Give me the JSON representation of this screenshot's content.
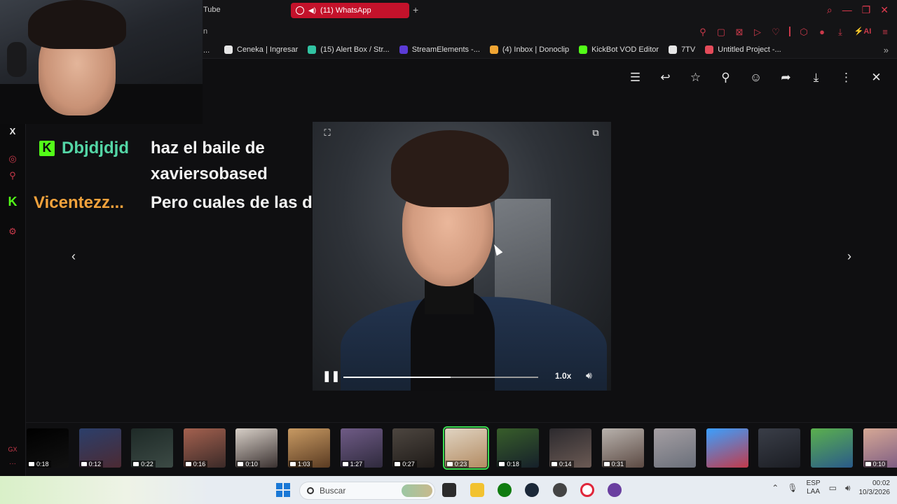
{
  "browser": {
    "tab_youtube_label": "Tube",
    "tab_active_label": "(11) WhatsApp",
    "url_fragment": "n",
    "bookmarks": [
      {
        "label": "Ceneka | Ingresar",
        "color": "#e6e6e6"
      },
      {
        "label": "(15) Alert Box / Str...",
        "color": "#31c3a2"
      },
      {
        "label": "StreamElements -...",
        "color": "#5b3bd6"
      },
      {
        "label": "(4) Inbox | Donoclip",
        "color": "#f0a533"
      },
      {
        "label": "KickBot VOD Editor",
        "color": "#53fc18"
      },
      {
        "label": "7TV",
        "color": "#e6e6e6"
      },
      {
        "label": "Untitled Project -...",
        "color": "#e44b5a"
      }
    ],
    "bookmark_overflow": "..."
  },
  "chat": {
    "messages": [
      {
        "user": "Dbjdjdjd",
        "user_color": "#54d6a6",
        "has_badge": true,
        "text": "haz el baile de xaviersobased"
      },
      {
        "user": "Vicentezz...",
        "user_color": "#f2a23c",
        "has_badge": false,
        "text": "Pero cuales de las dos"
      }
    ]
  },
  "sidebar": {
    "close_icon": "X"
  },
  "player": {
    "speed_label": "1.0x",
    "progress": 0.55,
    "playing": true
  },
  "thumbnails": [
    {
      "duration": "0:18",
      "c1": "#000000",
      "c2": "#111111"
    },
    {
      "duration": "0:12",
      "c1": "#2b3f6b",
      "c2": "#4c2a33"
    },
    {
      "duration": "0:22",
      "c1": "#1e2a27",
      "c2": "#3c4a45"
    },
    {
      "duration": "0:16",
      "c1": "#a4614f",
      "c2": "#3b2a28"
    },
    {
      "duration": "0:10",
      "c1": "#d8d0c8",
      "c2": "#3a3130"
    },
    {
      "duration": "1:03",
      "c1": "#c89a63",
      "c2": "#5a3b22"
    },
    {
      "duration": "1:27",
      "c1": "#6f5b86",
      "c2": "#2f2a3d"
    },
    {
      "duration": "0:27",
      "c1": "#4d4640",
      "c2": "#1f1b18"
    },
    {
      "duration": "0:23",
      "c1": "#e0d4c2",
      "c2": "#b38b62",
      "selected": true
    },
    {
      "duration": "0:18",
      "c1": "#385e2a",
      "c2": "#16202a"
    },
    {
      "duration": "0:14",
      "c1": "#2c2a2e",
      "c2": "#6b5a54"
    },
    {
      "duration": "0:31",
      "c1": "#b8b2ad",
      "c2": "#5c4a43"
    },
    {
      "duration": "",
      "c1": "#a59fa3",
      "c2": "#6a6f7a"
    },
    {
      "duration": "",
      "c1": "#3aa0ff",
      "c2": "#c23a4b"
    },
    {
      "duration": "",
      "c1": "#3a3e48",
      "c2": "#1b1d23"
    },
    {
      "duration": "",
      "c1": "#5bb04d",
      "c2": "#2a5a8a"
    },
    {
      "duration": "0:10",
      "c1": "#d6a895",
      "c2": "#7a5a82"
    }
  ],
  "taskbar": {
    "search_placeholder": "Buscar",
    "lang_top": "ESP",
    "lang_bottom": "LAA",
    "time": "00:02",
    "date": "10/3/2026"
  }
}
